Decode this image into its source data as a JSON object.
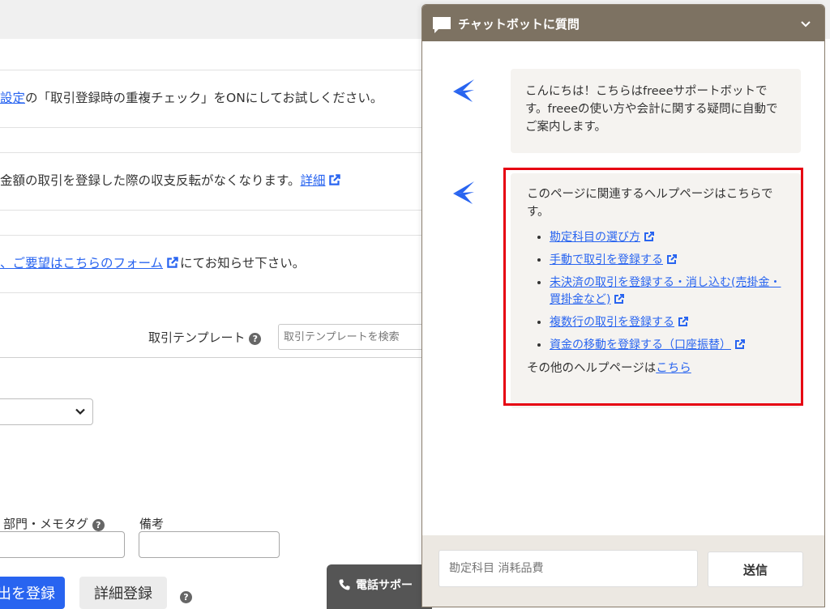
{
  "background": {
    "notices": [
      {
        "link": "設定",
        "text": "の「取引登録時の重複チェック」をONにしてお試しください。"
      },
      {
        "text": "金額の取引を登録した際の収支反転がなくなります。",
        "link": "詳細"
      },
      {
        "link": "、ご要望はこちらのフォーム",
        "text": "にてお知らせ下さい。"
      }
    ],
    "template_label": "取引テンプレート",
    "template_placeholder": "取引テンプレートを検索",
    "dept_label": "部門・メモタグ",
    "memo_label": "備考",
    "register_button": "出を登録",
    "detail_button": "詳細登録",
    "phone_tab": "電話サポー"
  },
  "chat": {
    "title": "チャットボットに質問",
    "greeting": "こんにちは！こちらはfreeeサポートボットです。freeeの使い方や会計に関する疑問に自動でご案内します。",
    "help_intro": "このページに関連するヘルプページはこちらです。",
    "help_links": [
      "勘定科目の選び方",
      "手動で取引を登録する",
      "未決済の取引を登録する・消し込む(売掛金・買掛金など)",
      "複数行の取引を登録する",
      "資金の移動を登録する（口座振替）"
    ],
    "other_prefix": "その他のヘルプページは",
    "other_link": "こちら",
    "input_placeholder": "勘定科目 消耗品費",
    "send_label": "送信"
  },
  "colors": {
    "header": "#7d7262",
    "link": "#2864f0",
    "primary": "#2864f0",
    "highlight": "#e60012",
    "bot_blue": "#2864f0"
  }
}
